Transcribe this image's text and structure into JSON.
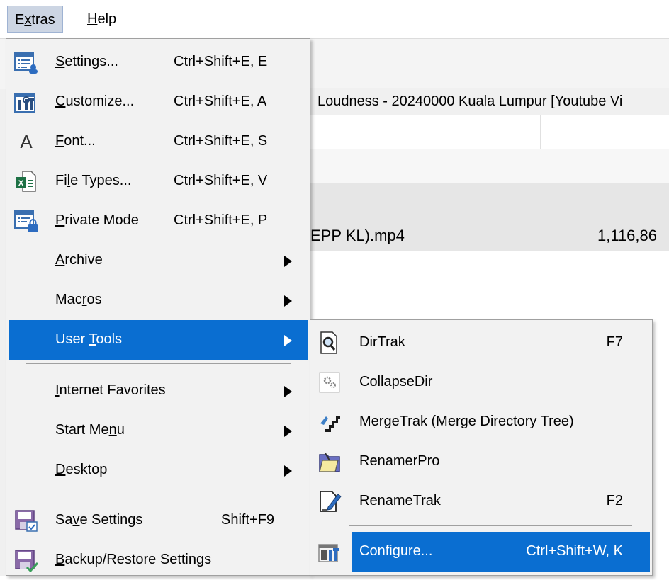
{
  "menubar": {
    "extras": {
      "pre": "E",
      "u": "x",
      "post": "tras"
    },
    "help": {
      "pre": "",
      "u": "H",
      "post": "elp"
    }
  },
  "background": {
    "tab_title": "Loudness - 20240000 Kuala Lumpur [Youtube Vi",
    "file_name": "EPP KL).mp4",
    "file_size": "1,116,86"
  },
  "extras_menu": {
    "settings": {
      "pre": "",
      "u": "S",
      "post": "ettings...",
      "shortcut": "Ctrl+Shift+E, E",
      "icon": "settings-list-icon"
    },
    "customize": {
      "pre": "",
      "u": "C",
      "post": "ustomize...",
      "shortcut": "Ctrl+Shift+E, A",
      "icon": "customize-tools-icon"
    },
    "font": {
      "pre": "",
      "u": "F",
      "post": "ont...",
      "shortcut": "Ctrl+Shift+E, S",
      "icon": "font-letter-icon",
      "glyph": "A"
    },
    "file_types": {
      "pre": "Fi",
      "u": "l",
      "post": "e Types...",
      "shortcut": "Ctrl+Shift+E, V",
      "icon": "excel-file-icon"
    },
    "private_mode": {
      "pre": "",
      "u": "P",
      "post": "rivate Mode",
      "shortcut": "Ctrl+Shift+E, P",
      "icon": "private-lock-icon"
    },
    "archive": {
      "pre": "",
      "u": "A",
      "post": "rchive"
    },
    "macros": {
      "pre": "Mac",
      "u": "r",
      "post": "os"
    },
    "user_tools": {
      "pre": "User ",
      "u": "T",
      "post": "ools"
    },
    "internet_favorites": {
      "pre": "",
      "u": "I",
      "post": "nternet Favorites"
    },
    "start_menu": {
      "pre": "Start Me",
      "u": "n",
      "post": "u"
    },
    "desktop": {
      "pre": "",
      "u": "D",
      "post": "esktop"
    },
    "save_settings": {
      "pre": "Sa",
      "u": "v",
      "post": "e Settings",
      "shortcut": "Shift+F9",
      "icon": "save-settings-icon"
    },
    "backup_restore": {
      "pre": "",
      "u": "B",
      "post": "ackup/Restore Settings",
      "icon": "backup-restore-icon"
    }
  },
  "user_tools_menu": {
    "dirtrak": {
      "label": "DirTrak",
      "shortcut": "F7",
      "icon": "dirtrak-magnifier-icon"
    },
    "collapsedir": {
      "label": "CollapseDir",
      "icon": "collapsedir-gears-icon"
    },
    "mergetrak": {
      "label": "MergeTrak (Merge Directory Tree)",
      "icon": "mergetrak-stairs-icon"
    },
    "renamerpro": {
      "label": "RenamerPro",
      "icon": "renamerpro-folder-icon"
    },
    "renametrak": {
      "label": "RenameTrak",
      "shortcut": "F2",
      "icon": "renametrak-pen-icon"
    },
    "configure": {
      "label": "Configure...",
      "shortcut": "Ctrl+Shift+W, K",
      "icon": "configure-tools-icon"
    }
  },
  "colors": {
    "highlight": "#0a6ed1",
    "menu_bg": "#f2f2f2",
    "menubar_active": "#ccd5e3"
  }
}
